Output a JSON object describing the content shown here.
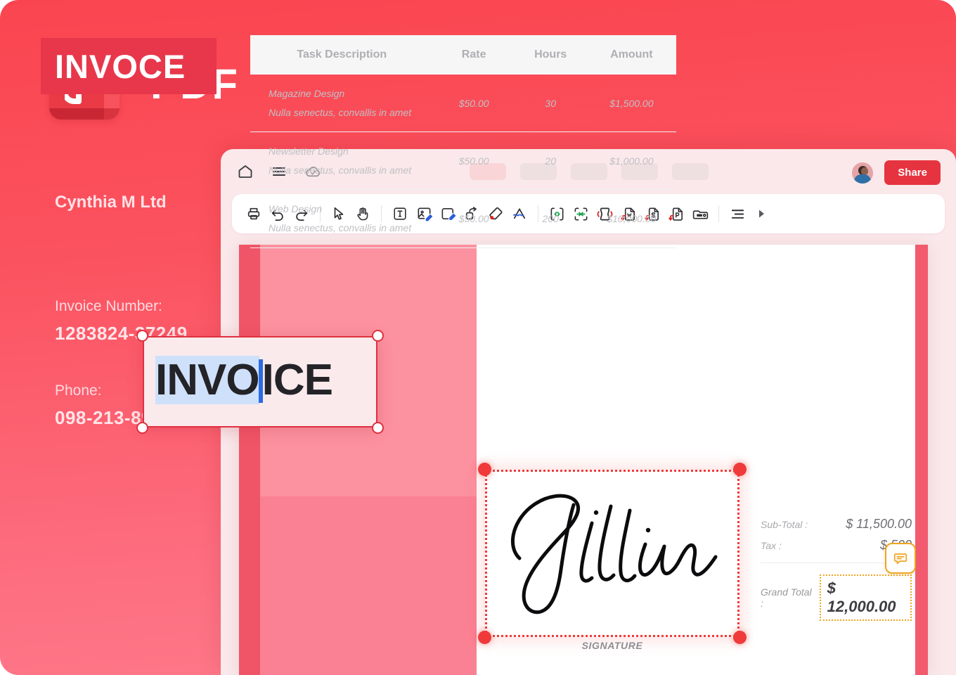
{
  "brand": {
    "title": "PDF",
    "logo_icon": "pdf-app-logo-icon"
  },
  "colors": {
    "accent_red": "#FA4550",
    "brand_tile": "#E93A45",
    "share_button": "#E5343F",
    "comment_orange": "#F0A420",
    "selection_blue": "#CFE0FA",
    "caret_blue": "#2B6BE4",
    "selection_red": "#F03A3A",
    "invoice_panel_pink": "#FC919F",
    "invoice_title_block": "#E8374B"
  },
  "app": {
    "header": {
      "icons": [
        {
          "name": "home-icon",
          "label": "Home"
        },
        {
          "name": "menu-icon",
          "label": "Menu"
        },
        {
          "name": "cloud-saved-icon",
          "label": "Saved to cloud"
        }
      ],
      "tabs": [
        {
          "name": "tab-1",
          "label": ""
        },
        {
          "name": "tab-2",
          "label": ""
        },
        {
          "name": "tab-3",
          "label": ""
        },
        {
          "name": "tab-4",
          "label": ""
        },
        {
          "name": "tab-5",
          "label": ""
        }
      ],
      "avatar_label": "User profile",
      "share_label": "Share"
    },
    "toolbar": {
      "items": [
        {
          "name": "print-icon",
          "label": "Print"
        },
        {
          "name": "undo-icon",
          "label": "Undo"
        },
        {
          "name": "redo-icon",
          "label": "Redo"
        },
        {
          "name": "select-cursor-icon",
          "label": "Select"
        },
        {
          "name": "pan-hand-icon",
          "label": "Pan"
        },
        {
          "name": "edit-text-icon",
          "label": "Edit text"
        },
        {
          "name": "edit-image-icon",
          "label": "Edit image"
        },
        {
          "name": "edit-page-icon",
          "label": "Edit page"
        },
        {
          "name": "link-icon",
          "label": "Link"
        },
        {
          "name": "eraser-icon",
          "label": "Eraser"
        },
        {
          "name": "signature-icon",
          "label": "Signature"
        },
        {
          "name": "split-pages-icon",
          "label": "Split pages"
        },
        {
          "name": "extract-pages-icon",
          "label": "Extract pages"
        },
        {
          "name": "compress-pdf-icon",
          "label": "Compress"
        },
        {
          "name": "convert-to-word-icon",
          "label": "PDF to Word"
        },
        {
          "name": "convert-to-excel-icon",
          "label": "PDF to Excel"
        },
        {
          "name": "convert-to-powerpoint-icon",
          "label": "PDF to PowerPoint"
        },
        {
          "name": "organize-pages-icon",
          "label": "Organize pages"
        },
        {
          "name": "align-icon",
          "label": "Align"
        },
        {
          "name": "more-tools-icon",
          "label": "More"
        }
      ]
    }
  },
  "document": {
    "title_block": "INVOCE",
    "company_name": "Cynthia M Ltd",
    "fields": [
      {
        "label": "Invoice Number:",
        "value": "1283824-37249"
      },
      {
        "label": "Phone:",
        "value": "098-213-892319"
      }
    ],
    "table": {
      "headers": [
        "Task Description",
        "Rate",
        "Hours",
        "Amount"
      ],
      "rows": [
        {
          "task_title": "Magazine Design",
          "task_sub": "Nulla senectus, convallis in amet",
          "rate": "$50.00",
          "hours": "30",
          "amount": "$1,500.00"
        },
        {
          "task_title": "Newsletter Design",
          "task_sub": "Nulla senectus, convallis in amet",
          "rate": "$50.00",
          "hours": "20",
          "amount": "$1,000.00"
        },
        {
          "task_title": "Web Design",
          "task_sub": "Nulla senectus, convallis in amet",
          "rate": "$50.00",
          "hours": "200",
          "amount": "$10,000.00"
        }
      ]
    },
    "totals": {
      "subtotal_label": "Sub-Total :",
      "subtotal_value": "$ 11,500.00",
      "tax_label": "Tax :",
      "tax_value": "$ 500",
      "grand_total_label": "Grand Total :",
      "grand_total_value": "$ 12,000.00"
    },
    "signature": {
      "name": "Jillian",
      "caption": "SIGNATURE"
    }
  },
  "text_edit_widget": {
    "selected_text": "INVO",
    "remaining_text": "ICE",
    "full_text": "INVOICE"
  }
}
